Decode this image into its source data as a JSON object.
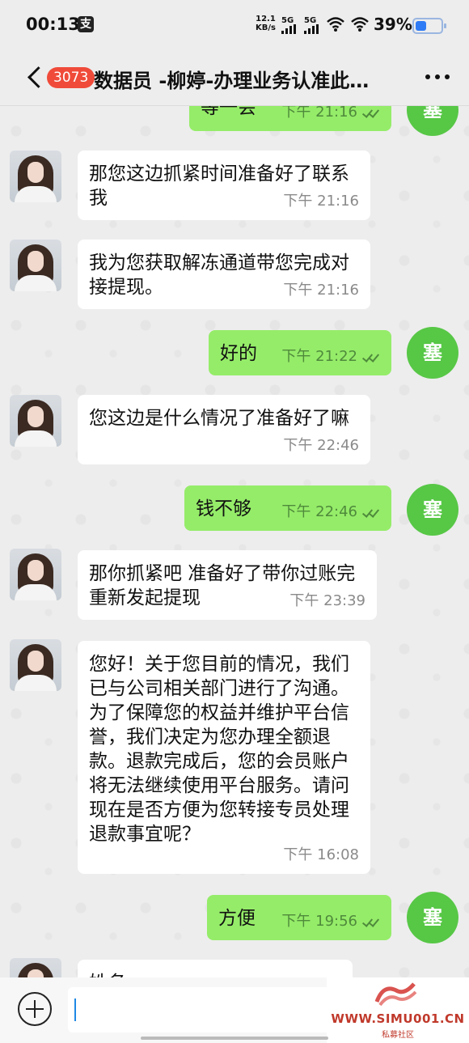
{
  "status_bar": {
    "time": "00:13",
    "badge": "支",
    "speed_value": "12.1",
    "speed_unit": "KB/s",
    "net1": "5G",
    "net2": "5G",
    "battery": "39%"
  },
  "header": {
    "unread_count": "3073",
    "title": "数据员 -柳婷-办理业务认准此…"
  },
  "messages": [
    {
      "side": "out",
      "text": "等一会",
      "time": "下午 21:16"
    },
    {
      "side": "in",
      "text": "那您这边抓紧时间准备好了联系我",
      "time": "下午 21:16"
    },
    {
      "side": "in",
      "text": "我为您获取解冻通道带您完成对接提现。",
      "time": "下午 21:16"
    },
    {
      "side": "out",
      "text": "好的",
      "time": "下午 21:22"
    },
    {
      "side": "in",
      "text": "您这边是什么情况了准备好了嘛",
      "time": "下午 22:46"
    },
    {
      "side": "out",
      "text": "钱不够",
      "time": "下午 22:46"
    },
    {
      "side": "in",
      "text": "那你抓紧吧 准备好了带你过账完重新发起提现",
      "time": "下午 23:39"
    },
    {
      "side": "in",
      "text": "您好！关于您目前的情况，我们已与公司相关部门进行了沟通。为了保障您的权益并维护平台信誉，我们决定为您办理全额退款。退款完成后，您的会员账户将无法继续使用平台服务。请问现在是否方便为您转接专员处理退款事宜呢？",
      "time": "下午 16:08"
    },
    {
      "side": "out",
      "text": "方便",
      "time": "下午 19:56"
    },
    {
      "side": "in",
      "text": "姓名",
      "time": ""
    }
  ],
  "self_avatar_label": "塞",
  "watermark": {
    "url": "WWW.SIMU001.CN",
    "sub": "私募社区"
  },
  "colors": {
    "incoming_bubble": "#ffffff",
    "outgoing_bubble": "#95ec69",
    "self_avatar": "#57c746",
    "unread_badge": "#f04b3a"
  }
}
